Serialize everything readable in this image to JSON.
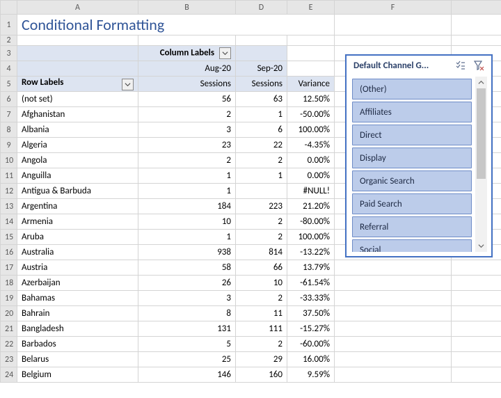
{
  "title": "Conditional Formatting",
  "col_headers": [
    "A",
    "B",
    "D",
    "E",
    "F"
  ],
  "pivot": {
    "column_labels_label": "Column Labels",
    "row_labels_label": "Row Labels",
    "months": [
      "Aug-20",
      "Sep-20"
    ],
    "measure_label": "Sessions",
    "variance_label": "Variance"
  },
  "rows": [
    {
      "n": 6,
      "label": "(not set)",
      "b": "56",
      "d": "63",
      "e": "12.50%"
    },
    {
      "n": 7,
      "label": "Afghanistan",
      "b": "2",
      "d": "1",
      "e": "-50.00%"
    },
    {
      "n": 8,
      "label": "Albania",
      "b": "3",
      "d": "6",
      "e": "100.00%"
    },
    {
      "n": 9,
      "label": "Algeria",
      "b": "23",
      "d": "22",
      "e": "-4.35%"
    },
    {
      "n": 10,
      "label": "Angola",
      "b": "2",
      "d": "2",
      "e": "0.00%"
    },
    {
      "n": 11,
      "label": "Anguilla",
      "b": "1",
      "d": "1",
      "e": "0.00%"
    },
    {
      "n": 12,
      "label": "Antigua & Barbuda",
      "b": "1",
      "d": "",
      "e": "#NULL!"
    },
    {
      "n": 13,
      "label": "Argentina",
      "b": "184",
      "d": "223",
      "e": "21.20%"
    },
    {
      "n": 14,
      "label": "Armenia",
      "b": "10",
      "d": "2",
      "e": "-80.00%"
    },
    {
      "n": 15,
      "label": "Aruba",
      "b": "1",
      "d": "2",
      "e": "100.00%"
    },
    {
      "n": 16,
      "label": "Australia",
      "b": "938",
      "d": "814",
      "e": "-13.22%"
    },
    {
      "n": 17,
      "label": "Austria",
      "b": "58",
      "d": "66",
      "e": "13.79%"
    },
    {
      "n": 18,
      "label": "Azerbaijan",
      "b": "26",
      "d": "10",
      "e": "-61.54%"
    },
    {
      "n": 19,
      "label": "Bahamas",
      "b": "3",
      "d": "2",
      "e": "-33.33%"
    },
    {
      "n": 20,
      "label": "Bahrain",
      "b": "8",
      "d": "11",
      "e": "37.50%"
    },
    {
      "n": 21,
      "label": "Bangladesh",
      "b": "131",
      "d": "111",
      "e": "-15.27%"
    },
    {
      "n": 22,
      "label": "Barbados",
      "b": "5",
      "d": "2",
      "e": "-60.00%"
    },
    {
      "n": 23,
      "label": "Belarus",
      "b": "25",
      "d": "29",
      "e": "16.00%"
    },
    {
      "n": 24,
      "label": "Belgium",
      "b": "146",
      "d": "160",
      "e": "9.59%"
    }
  ],
  "slicer": {
    "title": "Default Channel G...",
    "items": [
      "(Other)",
      "Affiliates",
      "Direct",
      "Display",
      "Organic Search",
      "Paid Search",
      "Referral",
      "Social"
    ]
  }
}
